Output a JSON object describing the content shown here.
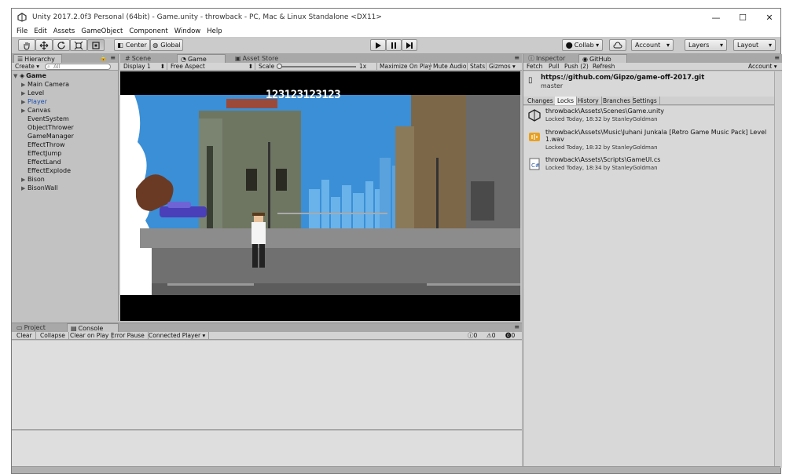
{
  "window": {
    "title": "Unity 2017.2.0f3 Personal (64bit) - Game.unity - throwback - PC, Mac & Linux Standalone <DX11>",
    "minimize": "—",
    "maximize": "☐",
    "close": "✕"
  },
  "menu": [
    "File",
    "Edit",
    "Assets",
    "GameObject",
    "Component",
    "Window",
    "Help"
  ],
  "toolbar": {
    "center_label": "Center",
    "global_label": "Global",
    "collab_label": "Collab ▾",
    "account_label": "Account",
    "layers_label": "Layers",
    "layout_label": "Layout"
  },
  "hierarchy": {
    "tab": "Hierarchy",
    "create_label": "Create ▾",
    "search_placeholder": "All",
    "scene_name": "Game",
    "items": [
      {
        "label": "Main Camera",
        "arrow": "▶",
        "depth": 1
      },
      {
        "label": "Level",
        "arrow": "▶",
        "depth": 1
      },
      {
        "label": "Player",
        "arrow": "▶",
        "depth": 1
      },
      {
        "label": "Canvas",
        "arrow": "▶",
        "depth": 1
      },
      {
        "label": "EventSystem",
        "arrow": "",
        "depth": 1
      },
      {
        "label": "ObjectThrower",
        "arrow": "",
        "depth": 1
      },
      {
        "label": "GameManager",
        "arrow": "",
        "depth": 1
      },
      {
        "label": "EffectThrow",
        "arrow": "",
        "depth": 1
      },
      {
        "label": "EffectJump",
        "arrow": "",
        "depth": 1
      },
      {
        "label": "EffectLand",
        "arrow": "",
        "depth": 1
      },
      {
        "label": "EffectExplode",
        "arrow": "",
        "depth": 1
      },
      {
        "label": "Bison",
        "arrow": "▶",
        "depth": 1
      },
      {
        "label": "BisonWall",
        "arrow": "▶",
        "depth": 1
      }
    ]
  },
  "center_tabs": {
    "scene": "Scene",
    "game": "Game",
    "asset_store": "Asset Store"
  },
  "gamebar": {
    "display": "Display 1",
    "aspect": "Free Aspect",
    "scale_label": "Scale",
    "scale_value": "1x",
    "maximize": "Maximize On Play",
    "mute": "Mute Audio",
    "stats": "Stats",
    "gizmos": "Gizmos ▾"
  },
  "game": {
    "score": "123123123123"
  },
  "bottom_tabs": {
    "project": "Project",
    "console": "Console"
  },
  "console": {
    "clear": "Clear",
    "collapse": "Collapse",
    "clear_on_play": "Clear on Play",
    "error_pause": "Error Pause",
    "connected": "Connected Player ▾",
    "info_count": "0",
    "warn_count": "0",
    "error_count": "0"
  },
  "right_tabs": {
    "inspector": "Inspector",
    "github": "GitHub"
  },
  "github": {
    "fetch": "Fetch",
    "pull": "Pull",
    "push": "Push (2)",
    "refresh": "Refresh",
    "account": "Account",
    "repo_url": "https://github.com/Gipzo/game-off-2017.git",
    "branch": "master",
    "tabs": [
      "Changes",
      "Locks",
      "History",
      "Branches",
      "Settings"
    ],
    "locks": [
      {
        "path": "throwback\\Assets\\Scenes\\Game.unity",
        "path2": "",
        "meta": "Locked Today, 18:32 by StanleyGoldman",
        "icon": "unity-scene-icon"
      },
      {
        "path": "throwback\\Assets\\Music\\Juhani Junkala [Retro Game Music Pack] Level",
        "path2": "1.wav",
        "meta": "Locked Today, 18:32 by StanleyGoldman",
        "icon": "audio-file-icon"
      },
      {
        "path": "throwback\\Assets\\Scripts\\GameUI.cs",
        "path2": "",
        "meta": "Locked Today, 18:34 by StanleyGoldman",
        "icon": "script-file-icon"
      }
    ]
  }
}
